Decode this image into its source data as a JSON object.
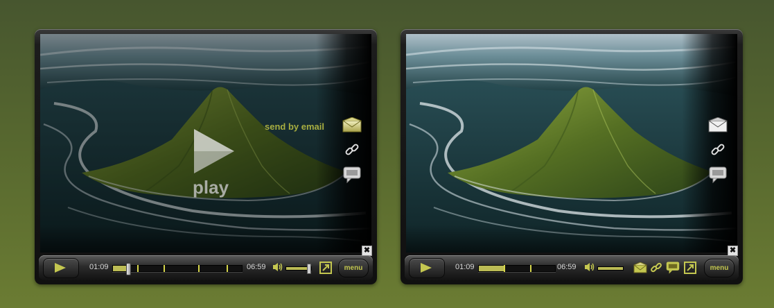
{
  "colors": {
    "accent": "#bcbc55",
    "label": "#a8ae40"
  },
  "player_left": {
    "overlay": {
      "play_label": "play",
      "email_label": "send by email"
    },
    "side_icons": [
      "envelope-icon",
      "link-icon",
      "comment-icon"
    ],
    "time_elapsed": "01:09",
    "time_total": "06:59",
    "progress": 0.1,
    "chapter_marks": 4,
    "volume": 1.0,
    "menu_label": "menu",
    "close_label": "✖"
  },
  "player_right": {
    "side_icons": [
      "envelope-icon",
      "link-icon",
      "comment-icon"
    ],
    "time_elapsed": "01:09",
    "time_total": "06:59",
    "progress": 0.35,
    "chapter_marks": 2,
    "volume": 1.0,
    "toolbar_icons": [
      "envelope-icon",
      "link-icon",
      "comment-icon",
      "fullscreen-icon"
    ],
    "menu_label": "menu",
    "close_label": "✖"
  }
}
